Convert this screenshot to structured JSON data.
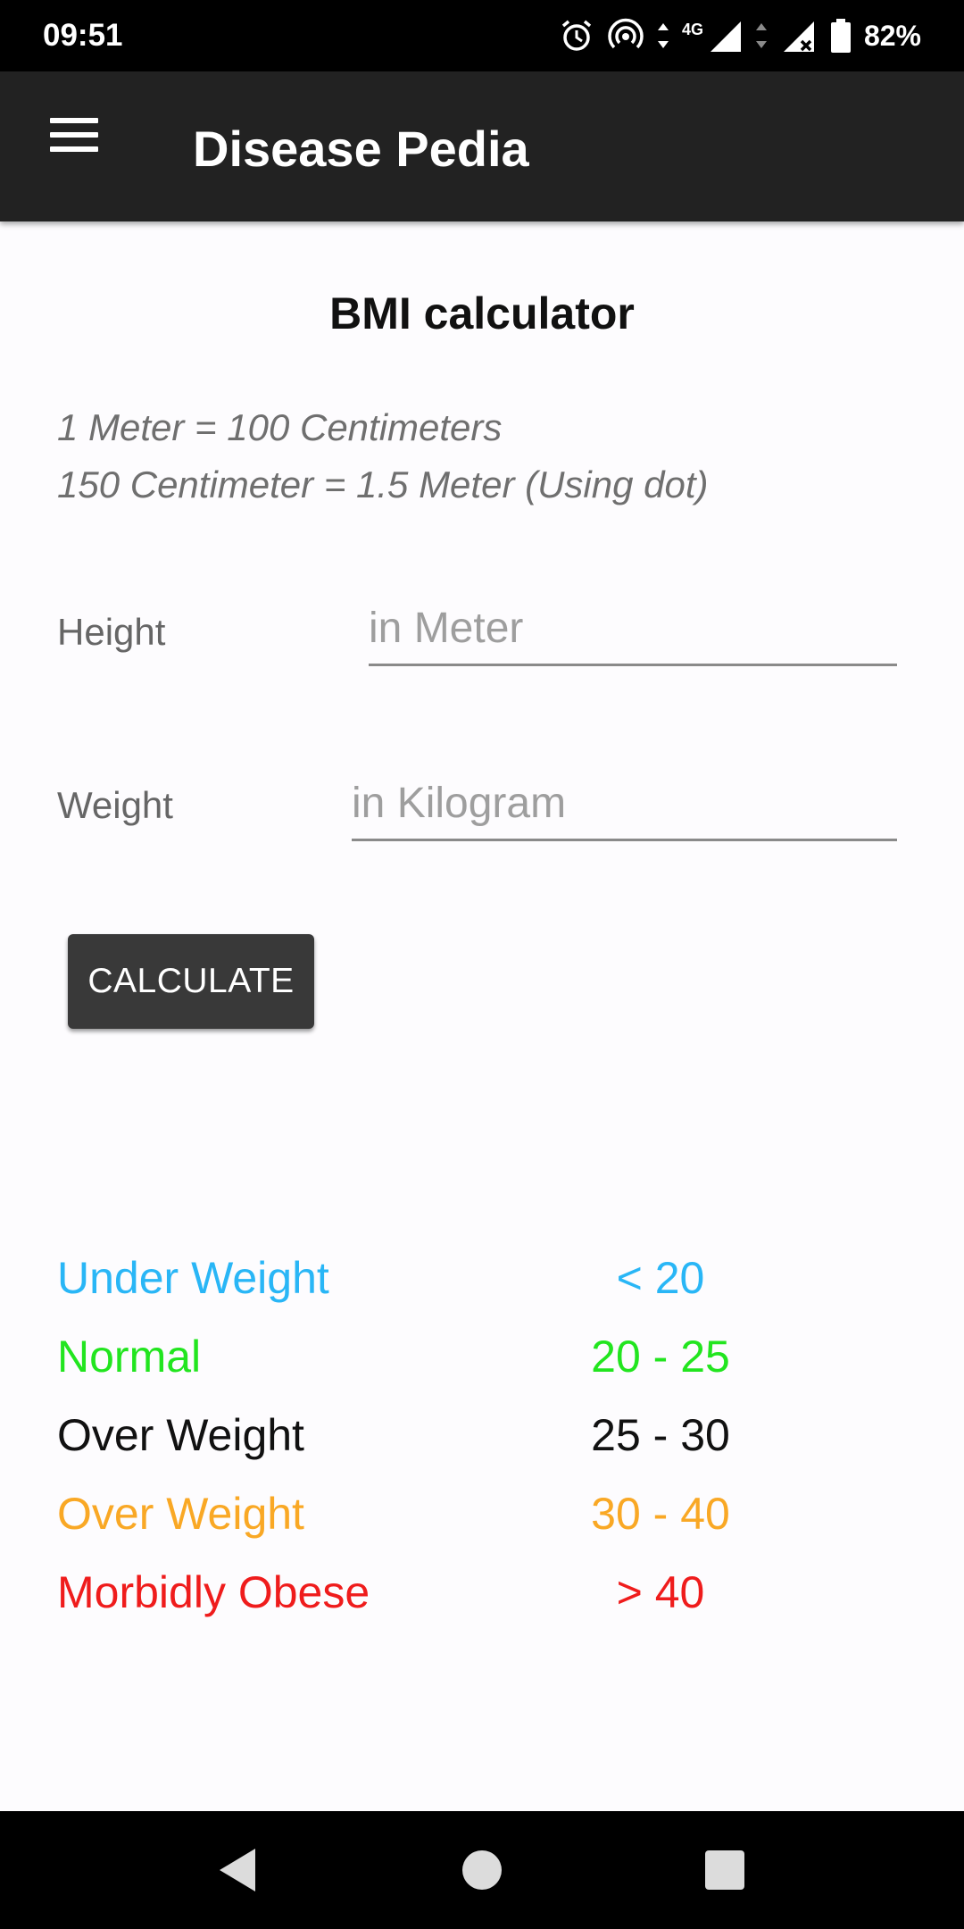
{
  "status_bar": {
    "time": "09:51",
    "network": "4G",
    "battery": "82%"
  },
  "app_bar": {
    "title": "Disease Pedia",
    "menu_icon": "hamburger-menu-icon"
  },
  "page": {
    "title": "BMI calculator",
    "info_lines": [
      "1 Meter = 100 Centimeters",
      "150 Centimeter = 1.5 Meter (Using dot)"
    ]
  },
  "form": {
    "height_label": "Height",
    "height_placeholder": "in Meter",
    "height_value": "",
    "weight_label": "Weight",
    "weight_placeholder": "in Kilogram",
    "weight_value": "",
    "calculate_label": "CALCULATE"
  },
  "bmi_table": [
    {
      "label": "Under Weight",
      "range": "< 20",
      "color": "#29b6f6"
    },
    {
      "label": "Normal",
      "range": "20 - 25",
      "color": "#22e51f"
    },
    {
      "label": "Over Weight",
      "range": "25 - 30",
      "color": "#111111"
    },
    {
      "label": "Over Weight",
      "range": "30 - 40",
      "color": "#f9a825"
    },
    {
      "label": "Morbidly Obese",
      "range": "> 40",
      "color": "#ef1c1c"
    }
  ],
  "nav_bar": {
    "back_icon": "back-triangle-icon",
    "home_icon": "home-circle-icon",
    "recents_icon": "recents-square-icon"
  }
}
